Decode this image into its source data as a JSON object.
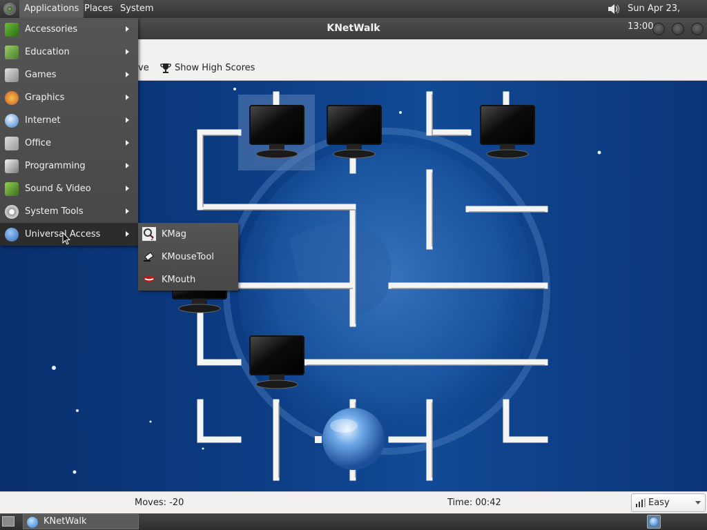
{
  "top_panel": {
    "menus": [
      "Applications",
      "Places",
      "System"
    ],
    "clock": "Sun Apr 23, 13:00"
  },
  "window": {
    "title": "KNetWalk",
    "toolbar": {
      "partial_label": "ve",
      "high_scores_label": "Show High Scores"
    }
  },
  "status_bar": {
    "moves": "Moves: -20",
    "time": "Time: 00:42",
    "difficulty": "Easy"
  },
  "applications_menu": {
    "items": [
      {
        "label": "Accessories",
        "icon": "accessories-icon"
      },
      {
        "label": "Education",
        "icon": "education-icon"
      },
      {
        "label": "Games",
        "icon": "games-icon"
      },
      {
        "label": "Graphics",
        "icon": "graphics-icon"
      },
      {
        "label": "Internet",
        "icon": "internet-icon"
      },
      {
        "label": "Office",
        "icon": "office-icon"
      },
      {
        "label": "Programming",
        "icon": "programming-icon"
      },
      {
        "label": "Sound & Video",
        "icon": "sound-video-icon"
      },
      {
        "label": "System Tools",
        "icon": "system-tools-icon"
      },
      {
        "label": "Universal Access",
        "icon": "universal-access-icon",
        "highlighted": true
      }
    ],
    "submenu": [
      {
        "label": "KMag",
        "icon": "kmag-icon"
      },
      {
        "label": "KMouseTool",
        "icon": "kmousetool-icon"
      },
      {
        "label": "KMouth",
        "icon": "kmouth-icon"
      }
    ]
  },
  "taskbar": {
    "task_label": "KNetWalk"
  },
  "colors": {
    "panel": "#3a3a3a",
    "menu_bg": "#4e4e4e",
    "menu_highlight": "#2c2c2c",
    "board_bg": "#0c3c82"
  }
}
